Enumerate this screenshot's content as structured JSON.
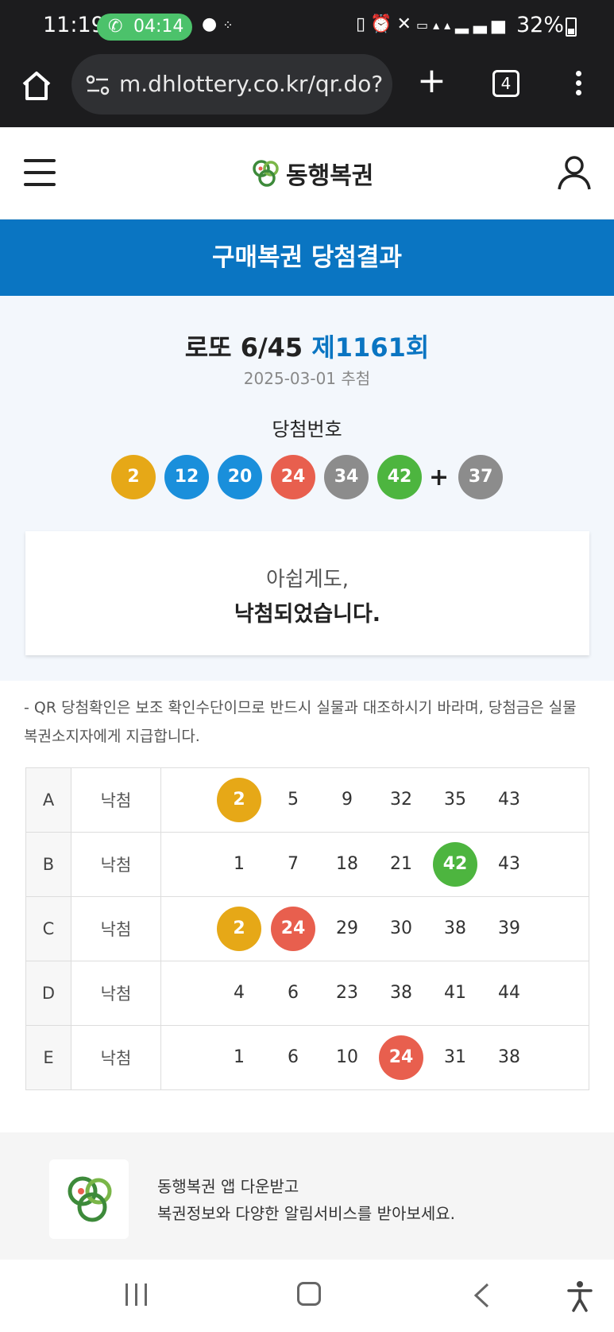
{
  "status_bar": {
    "time": "11:19",
    "call_timer": "04:14",
    "battery": "32%"
  },
  "browser": {
    "url": "m.dhlottery.co.kr/qr.do?m",
    "tab_count": "4"
  },
  "site": {
    "logo_text": "동행복권"
  },
  "page_title": "구매복권 당첨결과",
  "game": {
    "name": "로또 6/45",
    "round": "제1161회",
    "draw_date": "2025-03-01 추첨",
    "winning_label": "당첨번호",
    "winning_numbers": [
      {
        "n": "2",
        "color": "#e6a817"
      },
      {
        "n": "12",
        "color": "#1a8fdb"
      },
      {
        "n": "20",
        "color": "#1a8fdb"
      },
      {
        "n": "24",
        "color": "#e85f4e"
      },
      {
        "n": "34",
        "color": "#8c8c8c"
      },
      {
        "n": "42",
        "color": "#4db53f"
      }
    ],
    "plus": "+",
    "bonus_number": {
      "n": "37",
      "color": "#8c8c8c"
    }
  },
  "message": {
    "line1": "아쉽게도,",
    "line2": "낙첨되었습니다."
  },
  "notice": "- QR 당첨확인은 보조 확인수단이므로 반드시 실물과 대조하시기 바라며, 당첨금은 실물 복권소지자에게 지급합니다.",
  "tickets": [
    {
      "row": "A",
      "result": "낙첨",
      "numbers": [
        {
          "n": "2",
          "hit": true,
          "color": "#e6a817"
        },
        {
          "n": "5"
        },
        {
          "n": "9"
        },
        {
          "n": "32"
        },
        {
          "n": "35"
        },
        {
          "n": "43"
        }
      ]
    },
    {
      "row": "B",
      "result": "낙첨",
      "numbers": [
        {
          "n": "1"
        },
        {
          "n": "7"
        },
        {
          "n": "18"
        },
        {
          "n": "21"
        },
        {
          "n": "42",
          "hit": true,
          "color": "#4db53f"
        },
        {
          "n": "43"
        }
      ]
    },
    {
      "row": "C",
      "result": "낙첨",
      "numbers": [
        {
          "n": "2",
          "hit": true,
          "color": "#e6a817"
        },
        {
          "n": "24",
          "hit": true,
          "color": "#e85f4e"
        },
        {
          "n": "29"
        },
        {
          "n": "30"
        },
        {
          "n": "38"
        },
        {
          "n": "39"
        }
      ]
    },
    {
      "row": "D",
      "result": "낙첨",
      "numbers": [
        {
          "n": "4"
        },
        {
          "n": "6"
        },
        {
          "n": "23"
        },
        {
          "n": "38"
        },
        {
          "n": "41"
        },
        {
          "n": "44"
        }
      ]
    },
    {
      "row": "E",
      "result": "낙첨",
      "numbers": [
        {
          "n": "1"
        },
        {
          "n": "6"
        },
        {
          "n": "10"
        },
        {
          "n": "24",
          "hit": true,
          "color": "#e85f4e"
        },
        {
          "n": "31"
        },
        {
          "n": "38"
        }
      ]
    }
  ],
  "app_banner": {
    "line1": "동행복권 앱 다운받고",
    "line2": "복권정보와 다양한 알림서비스를 받아보세요."
  }
}
